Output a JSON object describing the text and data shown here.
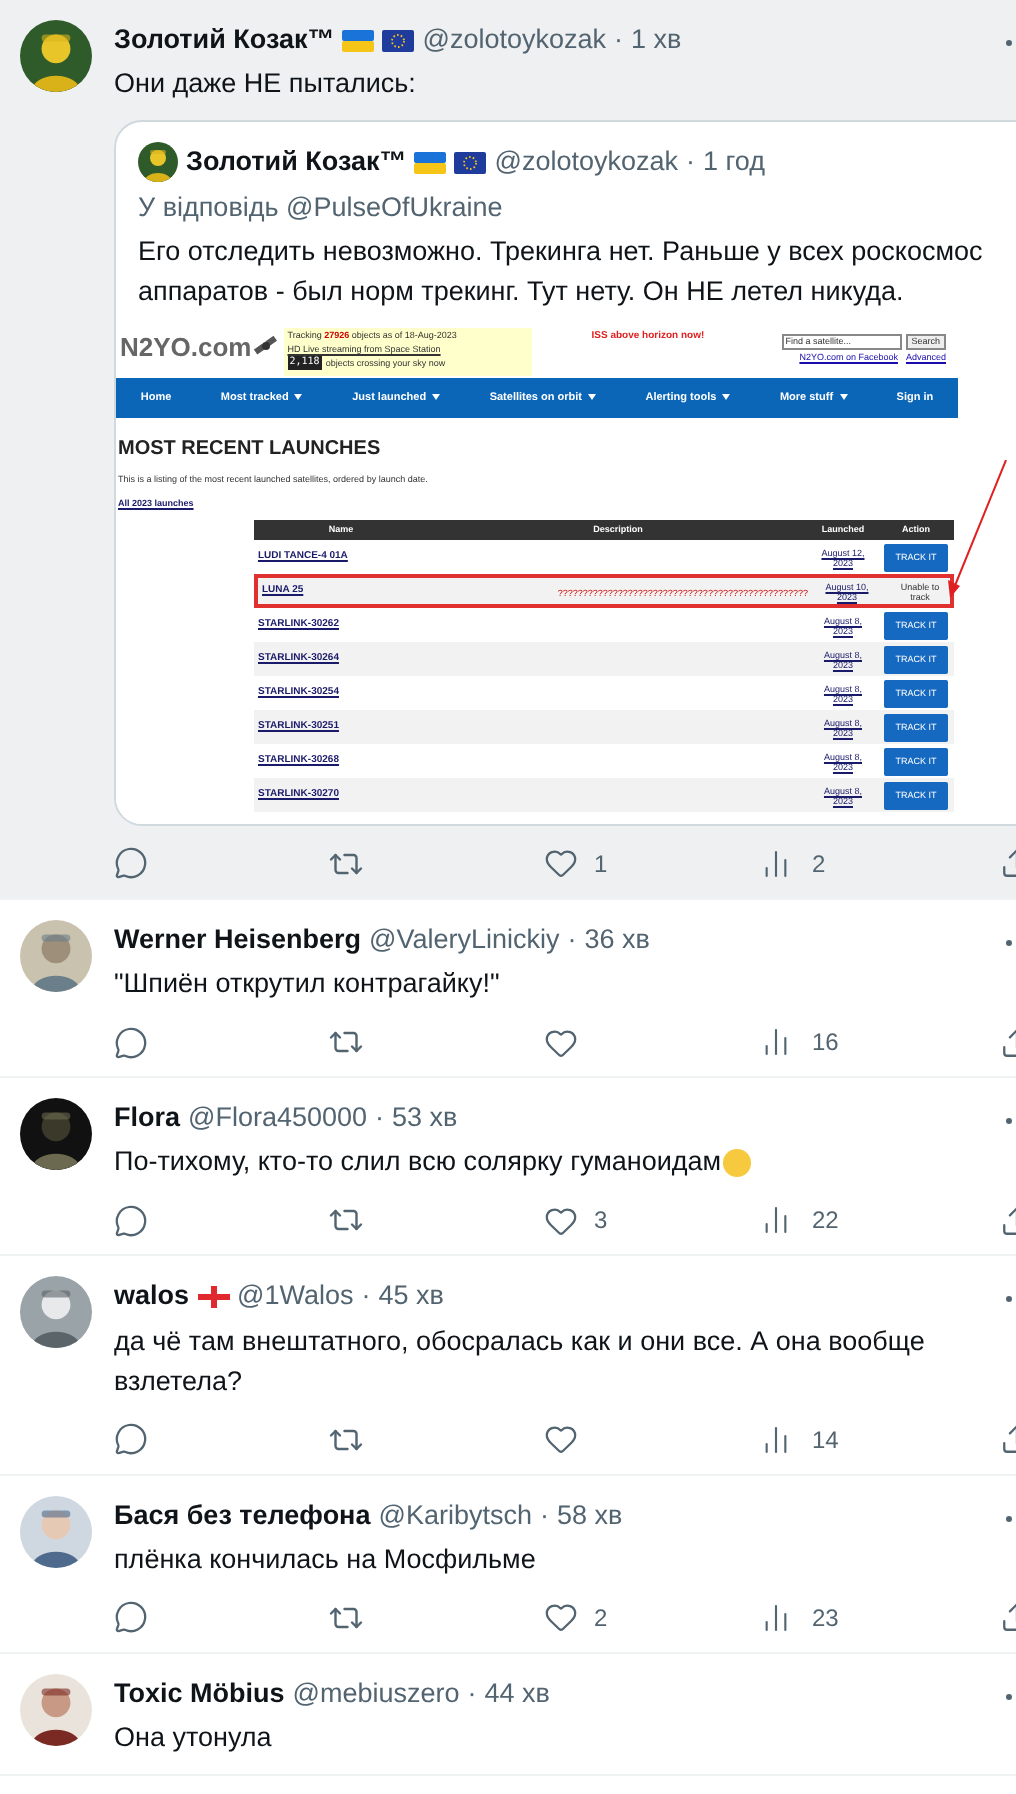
{
  "separator": "·",
  "tweets": [
    {
      "highlighted": true,
      "name": "Золотий Козак™",
      "badges": [
        {
          "kind": "ua"
        },
        {
          "kind": "eu"
        }
      ],
      "handle": "@zolotoykozak",
      "time": "1 хв",
      "text": "Они даже НЕ пытались:",
      "quote": {
        "name": "Золотий Козак™",
        "badges": [
          {
            "kind": "ua"
          },
          {
            "kind": "eu"
          }
        ],
        "handle": "@zolotoykozak",
        "time": "1 год",
        "reply_line": "У відповідь @PulseOfUkraine",
        "text": "Его отследить невозможно. Трекинга нет. Раньше у всех роскосмос аппаратов - был норм трекинг. Тут нету. Он НЕ летел никуда.",
        "screenshot": {
          "logo": "N2YO.com",
          "tracking_prefix": "Tracking ",
          "tracking_count": "27926",
          "tracking_suffix": " objects as of 18-Aug-2023",
          "live_link": "HD Live streaming from Space Station",
          "counter": "2,118",
          "crossing": "objects crossing your sky now",
          "iss": "ISS above horizon now!",
          "search_placeholder": "Find a satellite...",
          "search_button": "Search",
          "facebook": "N2YO.com on Facebook",
          "advanced": "Advanced",
          "nav": [
            {
              "label": "Home",
              "dropdown": false
            },
            {
              "label": "Most tracked",
              "dropdown": true
            },
            {
              "label": "Just launched",
              "dropdown": true
            },
            {
              "label": "Satellites on orbit",
              "dropdown": true
            },
            {
              "label": "Alerting tools",
              "dropdown": true
            },
            {
              "label": "More stuff",
              "dropdown": true
            },
            {
              "label": "Sign in",
              "dropdown": false
            }
          ],
          "title": "MOST RECENT LAUNCHES",
          "intro": "This is a listing of the most recent launched satellites, ordered by launch date.",
          "all_link": "All 2023 launches",
          "columns": [
            "Name",
            "Description",
            "Launched",
            "Action"
          ],
          "rows": [
            {
              "name": "LUDI TANCE-4 01A",
              "launched": "August 12, 2023",
              "action": {
                "kind": "button",
                "label": "TRACK IT"
              },
              "highlighted": false
            },
            {
              "name": "LUNA 25",
              "description": "??????????????????????????????????????????????????",
              "launched": "August 10, 2023",
              "action": {
                "kind": "note",
                "label": "Unable to track"
              },
              "highlighted": true
            },
            {
              "name": "STARLINK-30262",
              "launched": "August 8, 2023",
              "action": {
                "kind": "button",
                "label": "TRACK IT"
              },
              "highlighted": false
            },
            {
              "name": "STARLINK-30264",
              "launched": "August 8, 2023",
              "action": {
                "kind": "button",
                "label": "TRACK IT"
              },
              "highlighted": false
            },
            {
              "name": "STARLINK-30254",
              "launched": "August 8, 2023",
              "action": {
                "kind": "button",
                "label": "TRACK IT"
              },
              "highlighted": false
            },
            {
              "name": "STARLINK-30251",
              "launched": "August 8, 2023",
              "action": {
                "kind": "button",
                "label": "TRACK IT"
              },
              "highlighted": false
            },
            {
              "name": "STARLINK-30268",
              "launched": "August 8, 2023",
              "action": {
                "kind": "button",
                "label": "TRACK IT"
              },
              "highlighted": false
            },
            {
              "name": "STARLINK-30270",
              "launched": "August 8, 2023",
              "action": {
                "kind": "button",
                "label": "TRACK IT"
              },
              "highlighted": false
            }
          ]
        }
      },
      "stats": {
        "likes": "1",
        "views": "2"
      }
    },
    {
      "highlighted": false,
      "name": "Werner Heisenberg",
      "handle": "@ValeryLinickiy",
      "time": "36 хв",
      "text": "\"Шпиён открутил контрагайку!\"",
      "stats": {
        "views": "16"
      }
    },
    {
      "highlighted": false,
      "name": "Flora",
      "handle": "@Flora450000",
      "time": "53 хв",
      "text": "По-тихому, кто-то слил всю солярку гуманоидам",
      "emoji": true,
      "stats": {
        "likes": "3",
        "views": "22"
      }
    },
    {
      "highlighted": false,
      "name": "walos",
      "badges": [
        {
          "kind": "ge"
        }
      ],
      "handle": "@1Walos",
      "time": "45 хв",
      "text": "да чё там внештатного, обосралась как и они все. А она вообще взлетела?",
      "stats": {
        "views": "14"
      }
    },
    {
      "highlighted": false,
      "name": "Бася без телефона",
      "handle": "@Karibytsch",
      "time": "58 хв",
      "text": "плёнка кончилась на Мосфильме",
      "stats": {
        "likes": "2",
        "views": "23"
      }
    },
    {
      "highlighted": false,
      "name": "Toxic Möbius",
      "handle": "@mebiuszero",
      "time": "44 хв",
      "text": "Она утонула"
    }
  ]
}
